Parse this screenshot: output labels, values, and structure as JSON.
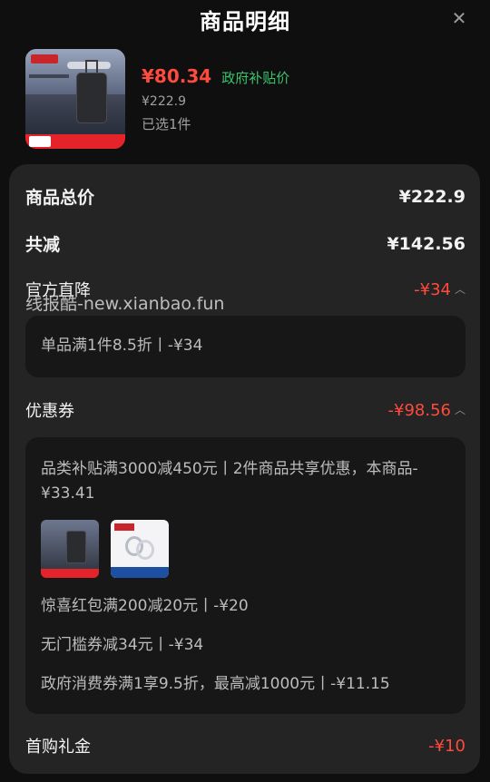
{
  "header": {
    "title": "商品明细",
    "close_icon": "close-icon"
  },
  "product": {
    "price": "¥80.34",
    "price_label": "政府补贴价",
    "original_price": "¥222.9",
    "selected": "已选1件"
  },
  "summary": {
    "total_label": "商品总价",
    "total_value": "¥222.9",
    "reduce_label": "共减",
    "reduce_value": "¥142.56"
  },
  "official": {
    "label": "官方直降",
    "value": "-¥34",
    "detail": "单品满1件8.5折丨-¥34"
  },
  "watermark": "线报酷-new.xianbao.fun",
  "coupon": {
    "label": "优惠券",
    "value": "-¥98.56",
    "items": [
      "品类补贴满3000减450元丨2件商品共享优惠，本商品-¥33.41",
      "惊喜红包满200减20元丨-¥20",
      "无门槛券减34元丨-¥34",
      "政府消费券满1享9.5折，最高减1000元丨-¥11.15"
    ]
  },
  "first_buy": {
    "label": "首购礼金",
    "value": "-¥10"
  },
  "colors": {
    "accent_red": "#ff4a3d",
    "green": "#39c46b",
    "card_bg": "#242424"
  }
}
